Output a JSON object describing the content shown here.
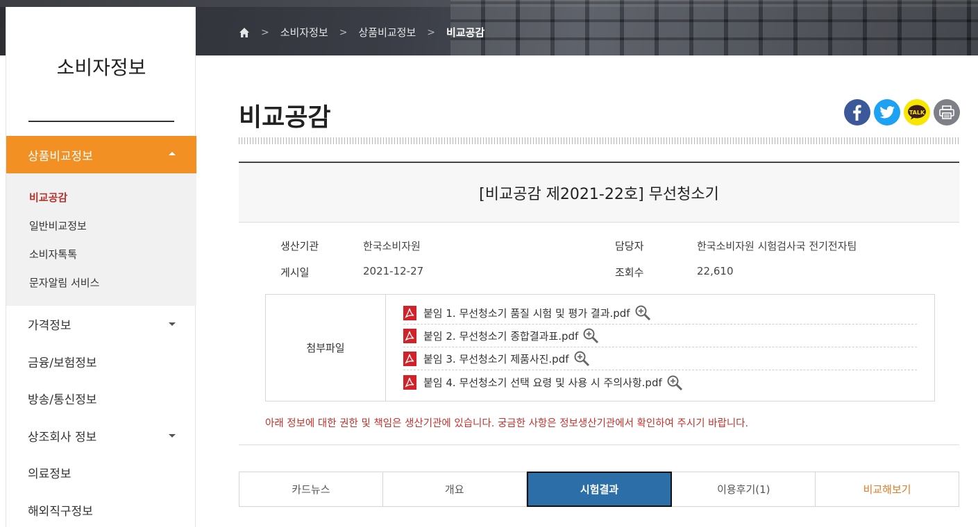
{
  "breadcrumb": {
    "items": [
      "소비자정보",
      "상품비교정보",
      "비교공감"
    ]
  },
  "sidebar": {
    "title": "소비자정보",
    "active_menu": "상품비교정보",
    "submenu": [
      "비교공감",
      "일반비교정보",
      "소비자톡톡",
      "문자알림 서비스"
    ],
    "menu": [
      "가격정보",
      "금융/보험정보",
      "방송/통신정보",
      "상조회사 정보",
      "의료정보",
      "해외직구정보"
    ]
  },
  "page": {
    "title": "비교공감"
  },
  "share": {
    "icons": [
      "facebook-icon",
      "twitter-icon",
      "kakaotalk-icon",
      "print-icon"
    ],
    "talk_text": "TALK"
  },
  "article": {
    "title": "[비교공감 제2021-22호] 무선청소기",
    "producer_label": "생산기관",
    "producer": "한국소비자원",
    "manager_label": "담당자",
    "manager": "한국소비자원 시험검사국 전기전자팀",
    "date_label": "게시일",
    "date": "2021-12-27",
    "views_label": "조회수",
    "views": "22,610",
    "attach_label": "첨부파일",
    "files": [
      "붙임 1. 무선청소기 품질 시험 및 평가 결과.pdf",
      "붙임 2. 무선청소기 종합결과표.pdf",
      "붙임 3. 무선청소기 제품사진.pdf",
      "붙임 4. 무선청소기 선택 요령 및 사용 시 주의사항.pdf"
    ],
    "notice": "아래 정보에 대한 권한 및 책임은 생산기관에 있습니다. 궁금한 사항은 정보생산기관에서 확인하여 주시기 바랍니다."
  },
  "tabs": [
    "카드뉴스",
    "개요",
    "시험결과",
    "이용후기(1)",
    "비교해보기"
  ],
  "colors": {
    "accent_orange": "#f39023",
    "tab_active": "#2b6ea8",
    "notice_red": "#c8312c"
  }
}
